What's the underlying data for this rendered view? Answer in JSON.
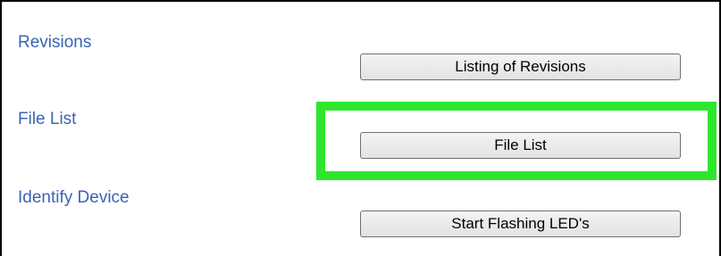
{
  "sections": [
    {
      "label": "Revisions",
      "button_label": "Listing of Revisions"
    },
    {
      "label": "File List",
      "button_label": "File List"
    },
    {
      "label": "Identify Device",
      "button_label": "Start Flashing LED's"
    }
  ],
  "colors": {
    "label_text": "#3a64b3",
    "highlight": "#2ee62e",
    "button_border": "#707070"
  }
}
